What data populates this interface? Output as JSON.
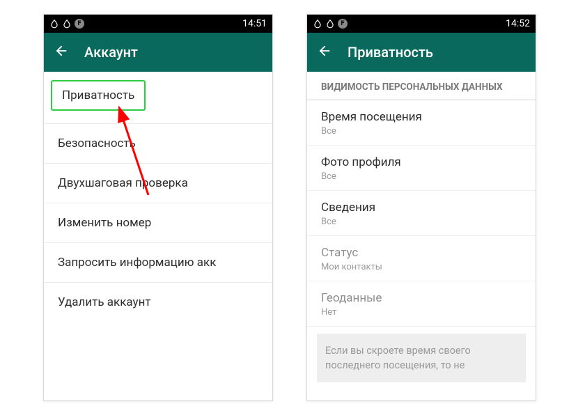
{
  "left": {
    "status_time": "14:51",
    "title": "Аккаунт",
    "highlighted": "Приватность",
    "items": [
      "Безопасность",
      "Двухшаговая проверка",
      "Изменить номер",
      "Запросить информацию акк",
      "Удалить аккаунт"
    ]
  },
  "right": {
    "status_time": "14:52",
    "title": "Приватность",
    "section": "ВИДИМОСТЬ ПЕРСОНАЛЬНЫХ ДАННЫХ",
    "settings": [
      {
        "title": "Время посещения",
        "value": "Все",
        "muted": false
      },
      {
        "title": "Фото профиля",
        "value": "Все",
        "muted": false
      },
      {
        "title": "Сведения",
        "value": "Все",
        "muted": false
      },
      {
        "title": "Статус",
        "value": "Мои контакты",
        "muted": true
      },
      {
        "title": "Геоданные",
        "value": "Нет",
        "muted": true
      }
    ],
    "hint": "Если вы скроете время своего последнего посещения, то не"
  }
}
